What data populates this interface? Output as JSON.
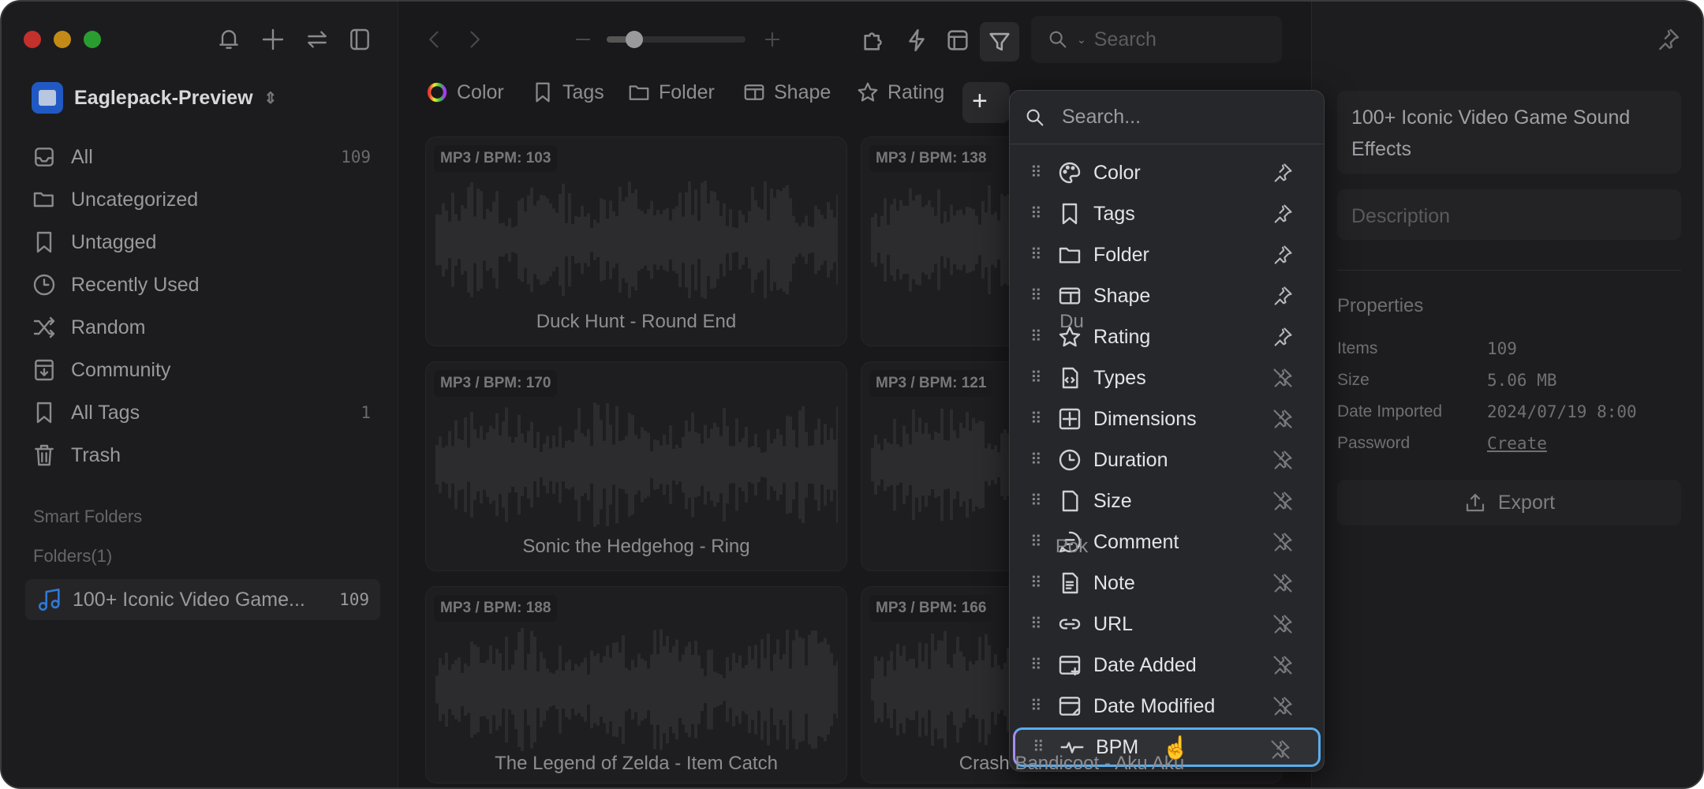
{
  "window": {
    "traffic_lights": [
      "#c4302b",
      "#c48a17",
      "#2a9d31"
    ]
  },
  "sidebar": {
    "library_name": "Eaglepack-Preview",
    "items": [
      {
        "label": "All",
        "count": "109",
        "icon": "inbox-icon"
      },
      {
        "label": "Uncategorized",
        "count": "",
        "icon": "folder-question-icon"
      },
      {
        "label": "Untagged",
        "count": "",
        "icon": "tag-question-icon"
      },
      {
        "label": "Recently Used",
        "count": "",
        "icon": "clock-icon"
      },
      {
        "label": "Random",
        "count": "",
        "icon": "shuffle-icon"
      },
      {
        "label": "Community",
        "count": "",
        "icon": "download-box-icon"
      },
      {
        "label": "All Tags",
        "count": "1",
        "icon": "bookmark-icon"
      },
      {
        "label": "Trash",
        "count": "",
        "icon": "trash-icon"
      }
    ],
    "smart_folders_label": "Smart Folders",
    "folders_label": "Folders(1)",
    "folder": {
      "label": "100+ Iconic Video Game...",
      "count": "109",
      "color": "#2f7ad8"
    }
  },
  "toolbar": {
    "search_placeholder": "Search",
    "zoom_level": 0.2
  },
  "filters": [
    {
      "label": "Color"
    },
    {
      "label": "Tags"
    },
    {
      "label": "Folder"
    },
    {
      "label": "Shape"
    },
    {
      "label": "Rating"
    }
  ],
  "cards": [
    {
      "badge": "MP3 / BPM: 103",
      "name": "Duck Hunt - Round End"
    },
    {
      "badge": "MP3 / BPM: 138",
      "name": "Du"
    },
    {
      "badge": "MP3 / BPM: 170",
      "name": "Sonic the Hedgehog - Ring"
    },
    {
      "badge": "MP3 / BPM: 121",
      "name": "Pok"
    },
    {
      "badge": "MP3 / BPM: 188",
      "name": "The Legend of Zelda - Item Catch"
    },
    {
      "badge": "MP3 / BPM: 166",
      "name": "Crash Bandicoot - Aku Aku"
    }
  ],
  "menu": {
    "search_placeholder": "Search...",
    "items": [
      {
        "label": "Color",
        "pinned": true
      },
      {
        "label": "Tags",
        "pinned": true
      },
      {
        "label": "Folder",
        "pinned": true
      },
      {
        "label": "Shape",
        "pinned": true
      },
      {
        "label": "Rating",
        "pinned": true
      },
      {
        "label": "Types",
        "pinned": false
      },
      {
        "label": "Dimensions",
        "pinned": false
      },
      {
        "label": "Duration",
        "pinned": false
      },
      {
        "label": "Size",
        "pinned": false
      },
      {
        "label": "Comment",
        "pinned": false
      },
      {
        "label": "Note",
        "pinned": false
      },
      {
        "label": "URL",
        "pinned": false
      },
      {
        "label": "Date Added",
        "pinned": false
      },
      {
        "label": "Date Modified",
        "pinned": false
      },
      {
        "label": "BPM",
        "pinned": false,
        "selected": true
      }
    ]
  },
  "inspector": {
    "title": "100+ Iconic Video Game Sound Effects",
    "description_placeholder": "Description",
    "properties_label": "Properties",
    "props": [
      {
        "label": "Items",
        "value": "109"
      },
      {
        "label": "Size",
        "value": "5.06 MB"
      },
      {
        "label": "Date Imported",
        "value": "2024/07/19 8:00"
      },
      {
        "label": "Password",
        "value": "Create"
      }
    ],
    "export_label": "Export"
  }
}
